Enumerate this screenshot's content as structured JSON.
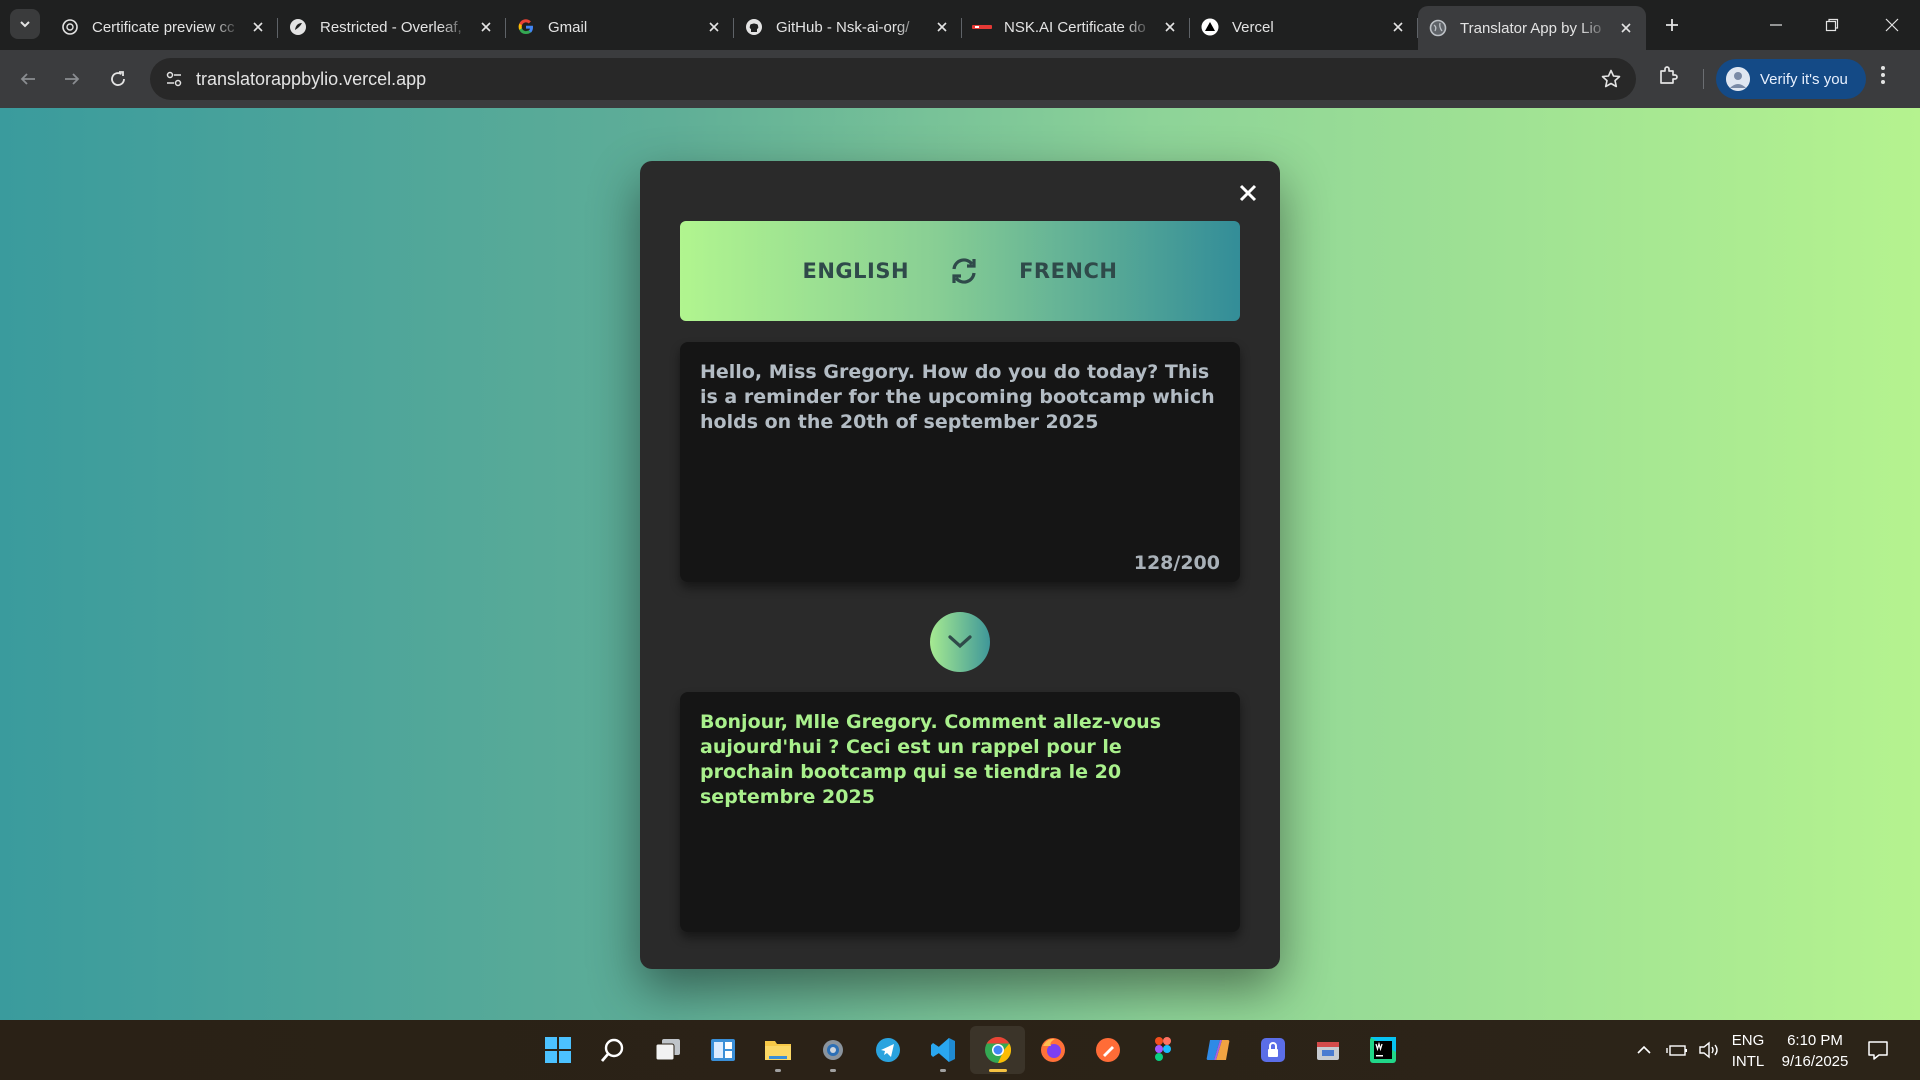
{
  "browser": {
    "tabs": [
      {
        "title": "Certificate preview cc",
        "favicon": "openai-icon"
      },
      {
        "title": "Restricted - Overleaf,",
        "favicon": "overleaf-icon"
      },
      {
        "title": "Gmail",
        "favicon": "google-icon"
      },
      {
        "title": "GitHub - Nsk-ai-org/",
        "favicon": "github-icon"
      },
      {
        "title": "NSK.AI Certificate do",
        "favicon": "nskai-icon"
      },
      {
        "title": "Vercel",
        "favicon": "vercel-icon"
      },
      {
        "title": "Translator App by Lio",
        "favicon": "globe-icon",
        "active": true
      }
    ],
    "url": "translatorappbylio.vercel.app",
    "verify_label": "Verify it's you"
  },
  "translator": {
    "source_lang": "ENGLISH",
    "target_lang": "FRENCH",
    "input_text": "Hello, Miss Gregory. How do you do today? This is a reminder for the upcoming bootcamp which holds on the 20th of september 2025",
    "misspelled_word": "september",
    "char_count": "128/200",
    "output_text": "Bonjour, Mlle Gregory. Comment allez-vous aujourd'hui ? Ceci est un rappel pour le prochain bootcamp qui se tiendra le 20 septembre 2025"
  },
  "taskbar": {
    "apps": [
      "windows-start-icon",
      "search-icon",
      "task-view-icon",
      "widgets-icon",
      "file-explorer-icon",
      "settings-icon",
      "telegram-icon",
      "vscode-icon",
      "chrome-icon",
      "firefox-icon",
      "postman-icon",
      "figma-icon",
      "copilot-icon",
      "password-manager-icon",
      "app-icon",
      "webstorm-icon"
    ],
    "lang_top": "ENG",
    "lang_bottom": "INTL",
    "time": "6:10 PM",
    "date": "9/16/2025"
  }
}
